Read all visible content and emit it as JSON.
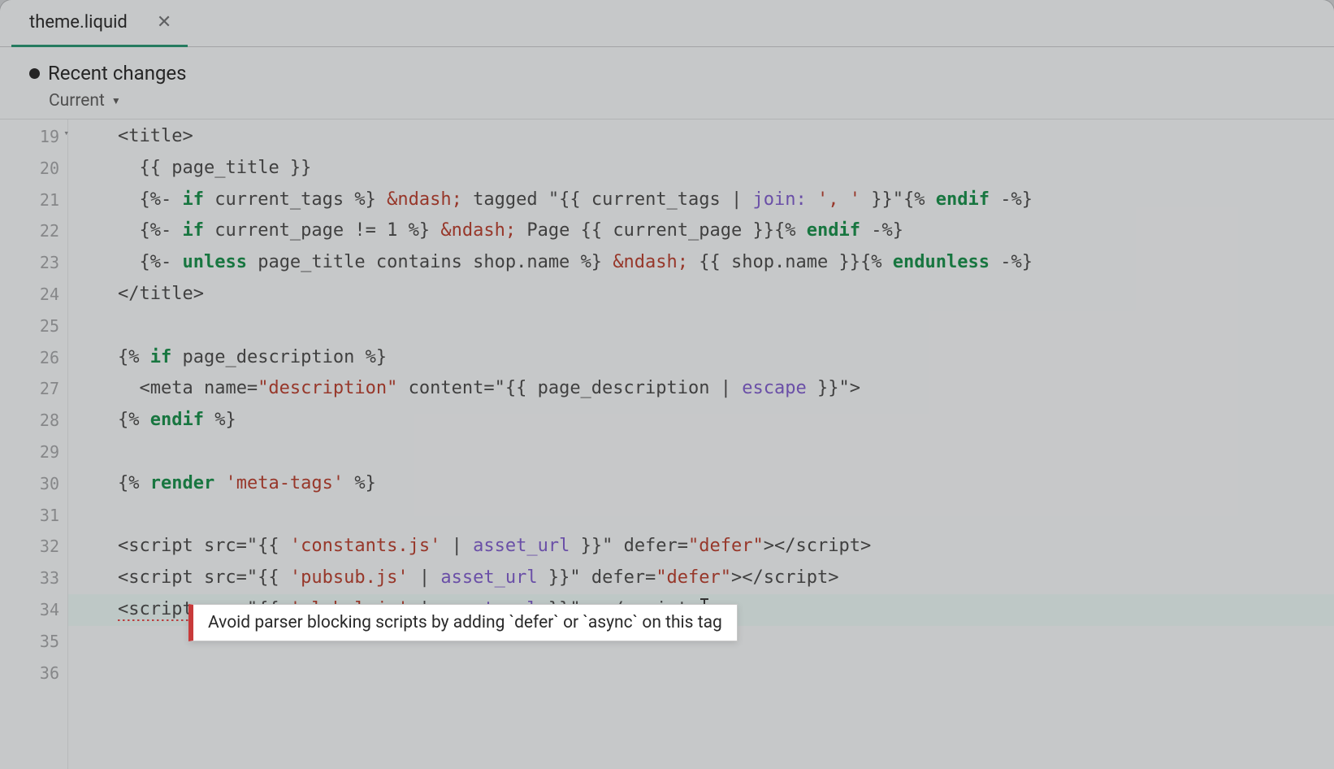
{
  "tab": {
    "filename": "theme.liquid"
  },
  "header": {
    "recent_changes": "Recent changes",
    "current_label": "Current"
  },
  "gutter": {
    "lines": [
      "19",
      "20",
      "21",
      "22",
      "23",
      "24",
      "25",
      "26",
      "27",
      "28",
      "29",
      "30",
      "31",
      "32",
      "33",
      "34",
      "35",
      "36"
    ]
  },
  "code": {
    "l19": {
      "open_title": "<title>"
    },
    "l20": {
      "braces_o": "{{ ",
      "var": "page_title",
      "braces_c": " }}"
    },
    "l21": {
      "do": "{%- ",
      "kw_if": "if",
      "var1": " current_tags ",
      "dc": "%} ",
      "amp": "&ndash;",
      "txt1": " tagged \"",
      "bo": "{{ ",
      "var2": "current_tags ",
      "pipe": "| ",
      "filter": "join:",
      "arg": " ', ' ",
      "bc": "}}",
      "txt2": "\"",
      "do2": "{% ",
      "kw_endif": "endif",
      "dc2": " -%}"
    },
    "l22": {
      "do": "{%- ",
      "kw_if": "if",
      "expr": " current_page != 1 ",
      "dc": "%} ",
      "amp": "&ndash;",
      "txt1": " Page ",
      "bo": "{{ ",
      "var": "current_page ",
      "bc": "}}",
      "do2": "{% ",
      "kw_endif": "endif",
      "dc2": " -%}"
    },
    "l23": {
      "do": "{%- ",
      "kw_unless": "unless",
      "expr": " page_title contains shop.name ",
      "dc": "%} ",
      "amp": "&ndash;",
      "sp": " ",
      "bo": "{{ ",
      "var": "shop.name ",
      "bc": "}}",
      "do2": "{% ",
      "kw_end": "endunless",
      "dc2": " -%}"
    },
    "l24": {
      "close_title": "</title>"
    },
    "l26": {
      "do": "{% ",
      "kw_if": "if",
      "var": " page_description ",
      "dc": "%}"
    },
    "l27": {
      "tag_o": "<meta name=",
      "attr_name": "\"description\"",
      "content_a": " content=\"",
      "bo": "{{ ",
      "var": "page_description ",
      "pipe": "| ",
      "filter": "escape",
      "bc": " }}",
      "content_c": "\">"
    },
    "l28": {
      "do": "{% ",
      "kw_endif": "endif",
      "dc": " %}"
    },
    "l30": {
      "do": "{% ",
      "kw_render": "render",
      "str": " 'meta-tags' ",
      "dc": "%}"
    },
    "l32": {
      "tag_o": "<script src=\"",
      "bo": "{{ ",
      "str": "'constants.js' ",
      "pipe": "| ",
      "filter": "asset_url",
      "bc": " }}",
      "attrs": "\" defer=",
      "defer_v": "\"defer\"",
      "close": "></script>"
    },
    "l33": {
      "tag_o": "<script src=\"",
      "bo": "{{ ",
      "str": "'pubsub.js' ",
      "pipe": "| ",
      "filter": "asset_url",
      "bc": " }}",
      "attrs": "\" defer=",
      "defer_v": "\"defer\"",
      "close": "></script>"
    },
    "l34": {
      "tag_o": "<script src=\"",
      "bo": "{{ ",
      "str": "'global.js' ",
      "pipe": "| ",
      "filter": "asset_url",
      "bc": " }}",
      "attrs": "\" >",
      "close": "</script>"
    }
  },
  "tooltip": {
    "message": "Avoid parser blocking scripts by adding `defer` or `async` on this tag"
  }
}
